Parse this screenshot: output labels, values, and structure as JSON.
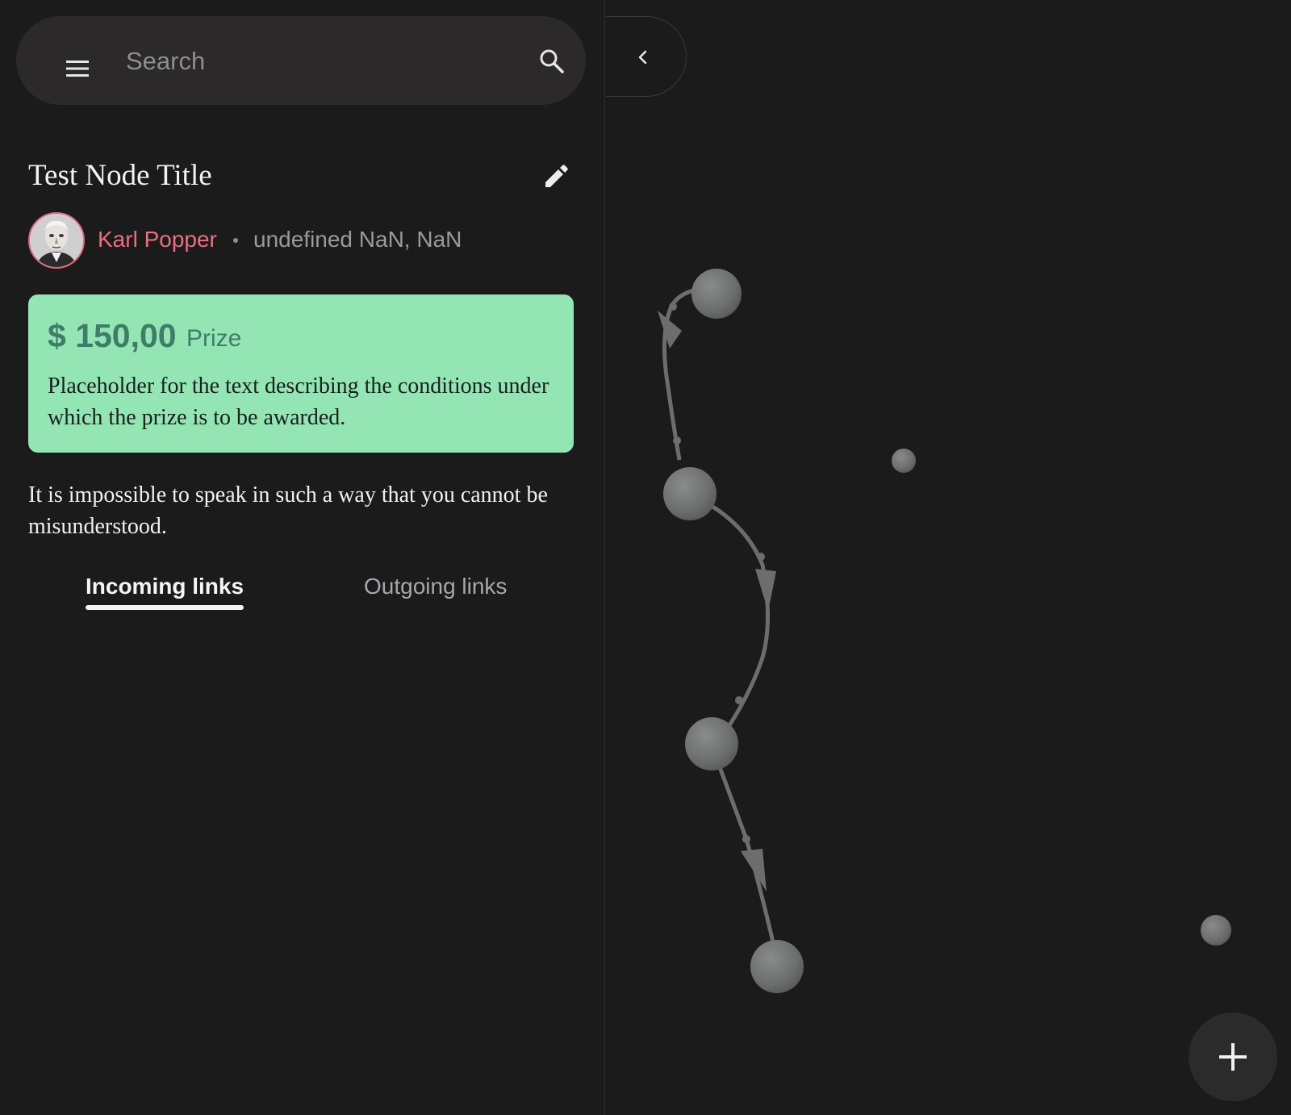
{
  "search": {
    "placeholder": "Search",
    "value": ""
  },
  "node": {
    "title": "Test Node Title",
    "author": "Karl Popper",
    "date": "undefined NaN, NaN",
    "prize": {
      "amount": "$ 150,00",
      "label": "Prize",
      "conditions": "Placeholder for the text describing the conditions under which the prize is to be awarded."
    },
    "body": "It is impossible to speak in such a way that you cannot be misunderstood."
  },
  "tabs": {
    "incoming": "Incoming links",
    "outgoing": "Outgoing links",
    "active": "incoming"
  },
  "icons": {
    "menu": "menu-icon",
    "search": "search-icon",
    "edit": "pencil-icon",
    "collapse": "chevron-left-icon",
    "add": "plus-icon"
  },
  "colors": {
    "background": "#1c1b1c",
    "accent_author": "#ea6f7f",
    "prize_background": "#94e5b4",
    "prize_amount": "#3f7d66",
    "node_sphere": "#6f7170"
  },
  "graph": {
    "nodes": [
      "node-1",
      "node-2",
      "node-3",
      "node-4",
      "node-5",
      "node-6"
    ],
    "links": [
      [
        "node-1",
        "node-2"
      ],
      [
        "node-2",
        "node-3"
      ],
      [
        "node-3",
        "node-4"
      ]
    ]
  }
}
